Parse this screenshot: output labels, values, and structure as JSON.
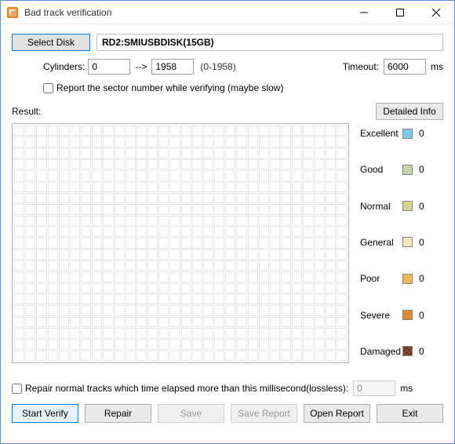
{
  "window": {
    "title": "Bad track verification"
  },
  "toolbar": {
    "select_disk": "Select Disk",
    "disk_name": "RD2:SMIUSBDISK(15GB)"
  },
  "cyl": {
    "label": "Cylinders:",
    "from": "0",
    "arrow": "-->",
    "to": "1958",
    "range": "(0-1958)"
  },
  "timeout": {
    "label": "Timeout:",
    "value": "6000",
    "unit": "ms"
  },
  "options": {
    "report_sector": "Report the sector number while verifying (maybe slow)"
  },
  "result": {
    "label": "Result:",
    "detailed_btn": "Detailed Info"
  },
  "legend": {
    "items": [
      {
        "label": "Excellent",
        "count": "0",
        "class": "sw-excellent"
      },
      {
        "label": "Good",
        "count": "0",
        "class": "sw-good"
      },
      {
        "label": "Normal",
        "count": "0",
        "class": "sw-normal"
      },
      {
        "label": "General",
        "count": "0",
        "class": "sw-general"
      },
      {
        "label": "Poor",
        "count": "0",
        "class": "sw-poor"
      },
      {
        "label": "Severe",
        "count": "0",
        "class": "sw-severe"
      },
      {
        "label": "Damaged",
        "count": "0",
        "class": "sw-damaged"
      }
    ]
  },
  "repair": {
    "label": "Repair normal tracks which time elapsed more than this millisecond(lossless):",
    "value": "0",
    "unit": "ms"
  },
  "buttons": {
    "start": "Start Verify",
    "repair": "Repair",
    "save": "Save",
    "save_report": "Save Report",
    "open_report": "Open Report",
    "exit": "Exit"
  }
}
